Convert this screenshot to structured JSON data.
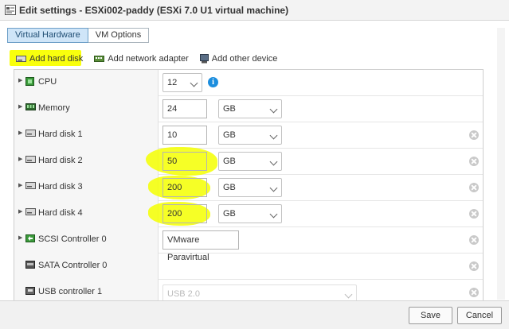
{
  "window": {
    "title": "Edit settings - ESXi002-paddy (ESXi 7.0 U1 virtual machine)"
  },
  "tabs": [
    {
      "label": "Virtual Hardware",
      "active": true
    },
    {
      "label": "VM Options",
      "active": false
    }
  ],
  "actions": {
    "add_hard_disk": "Add hard disk",
    "add_network_adapter": "Add network adapter",
    "add_other_device": "Add other device"
  },
  "devices": {
    "cpu": {
      "label": "CPU",
      "value": "12"
    },
    "memory": {
      "label": "Memory",
      "value": "24",
      "unit": "GB"
    },
    "hard_disk_1": {
      "label": "Hard disk 1",
      "value": "10",
      "unit": "GB"
    },
    "hard_disk_2": {
      "label": "Hard disk 2",
      "value": "50",
      "unit": "GB"
    },
    "hard_disk_3": {
      "label": "Hard disk 3",
      "value": "200",
      "unit": "GB"
    },
    "hard_disk_4": {
      "label": "Hard disk 4",
      "value": "200",
      "unit": "GB"
    },
    "scsi_controller_0": {
      "label": "SCSI Controller 0",
      "value": "VMware Paravirtual"
    },
    "sata_controller_0": {
      "label": "SATA Controller 0"
    },
    "usb_controller_1": {
      "label": "USB controller 1",
      "value": "USB 2.0"
    }
  },
  "footer": {
    "save": "Save",
    "cancel": "Cancel"
  },
  "colors": {
    "highlight": "#f4ff00",
    "active_tab": "#cfe5f8",
    "info": "#1c8ede"
  }
}
